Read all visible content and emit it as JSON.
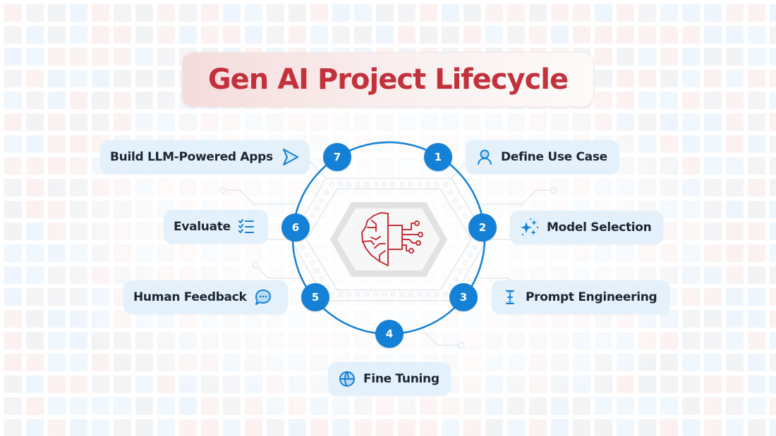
{
  "title": "Gen AI Project Lifecycle",
  "colors": {
    "title": "#c3323c",
    "accent_blue": "#1481d6",
    "pill_bg": "#e4f1fb",
    "label_text": "#1b2633",
    "brain_icon": "#c3323c"
  },
  "center": {
    "icon": "brain-circuit-icon"
  },
  "steps": [
    {
      "number": "1",
      "label": "Define Use Case",
      "icon": "user-icon"
    },
    {
      "number": "2",
      "label": "Model Selection",
      "icon": "sparkles-icon"
    },
    {
      "number": "3",
      "label": "Prompt Engineering",
      "icon": "text-cursor-icon"
    },
    {
      "number": "4",
      "label": "Fine Tuning",
      "icon": "globe-icon"
    },
    {
      "number": "5",
      "label": "Human Feedback",
      "icon": "chat-bubble-icon"
    },
    {
      "number": "6",
      "label": "Evaluate",
      "icon": "checklist-icon"
    },
    {
      "number": "7",
      "label": "Build LLM-Powered Apps",
      "icon": "play-arrow-icon"
    }
  ]
}
